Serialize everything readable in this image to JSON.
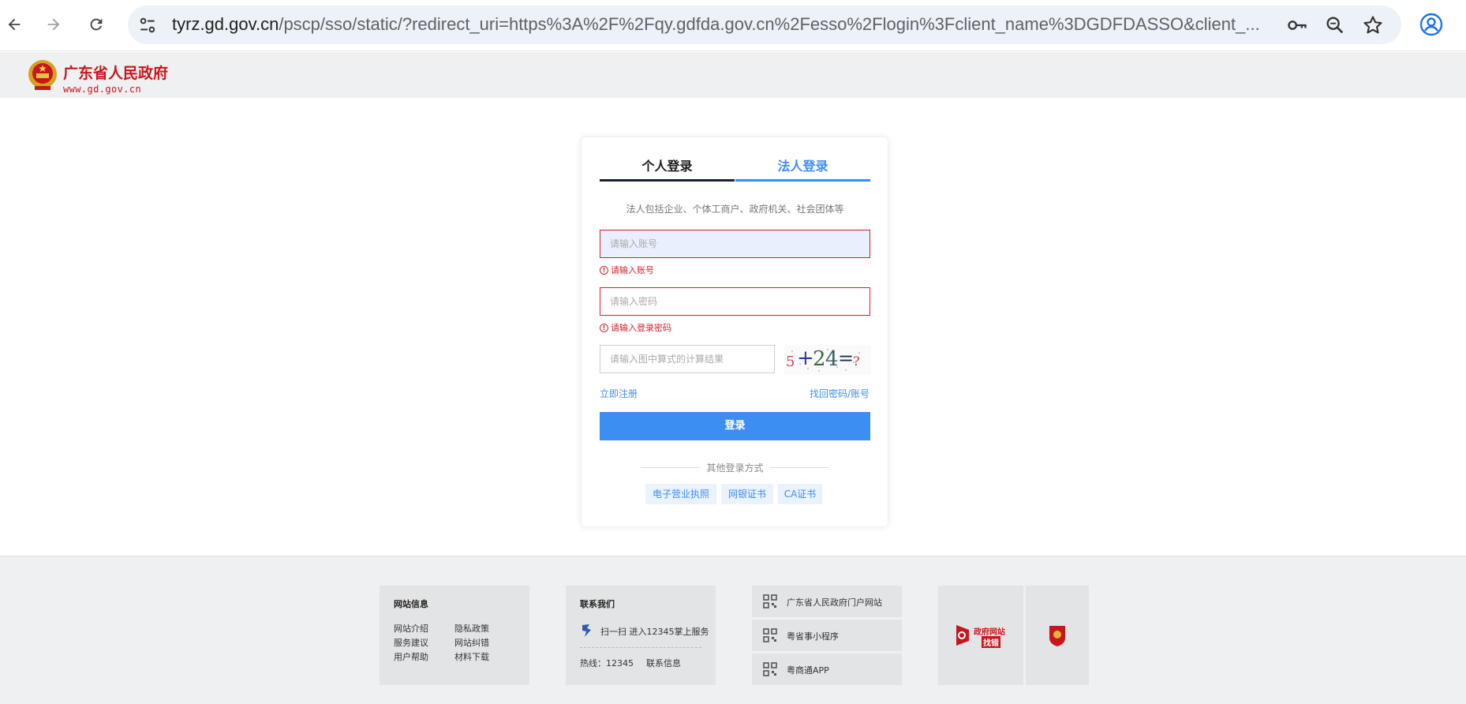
{
  "browser": {
    "url_host": "tyrz.gd.gov.cn",
    "url_path": "/pscp/sso/static/?redirect_uri=https%3A%2F%2Fqy.gdfda.gov.cn%2Fesso%2Flogin%3Fclient_name%3DGDFDASSO&client_..."
  },
  "site": {
    "name": "广东省人民政府",
    "url": "www.gd.gov.cn"
  },
  "login": {
    "tab_personal": "个人登录",
    "tab_legal": "法人登录",
    "hint": "法人包括企业、个体工商户、政府机关、社会团体等",
    "account_placeholder": "请输入账号",
    "account_error": "请输入账号",
    "password_placeholder": "请输入密码",
    "password_error": "请输入登录密码",
    "captcha_placeholder": "请输入图中算式的计算结果",
    "captcha_text": "5+24=?",
    "register_link": "立即注册",
    "recover_link": "找回密码/账号",
    "login_button": "登录",
    "other_methods_label": "其他登录方式",
    "methods": [
      "电子营业执照",
      "网银证书",
      "CA证书"
    ]
  },
  "footer": {
    "site_info": {
      "title": "网站信息",
      "links": [
        "网站介绍",
        "隐私政策",
        "服务建议",
        "网站纠错",
        "用户帮助",
        "材料下载"
      ]
    },
    "contact": {
      "title": "联系我们",
      "scan_text": "扫一扫 进入12345掌上服务",
      "hotline": "热线：12345",
      "contact_info": "联系信息"
    },
    "qr_items": [
      "广东省人民政府门户网站",
      "粤省事小程序",
      "粤商通APP"
    ],
    "badge_text_1": "政府网站",
    "badge_text_2": "找错"
  },
  "colors": {
    "accent": "#3d8ef2",
    "error": "#d81e2c",
    "brand_red": "#c8161d"
  }
}
